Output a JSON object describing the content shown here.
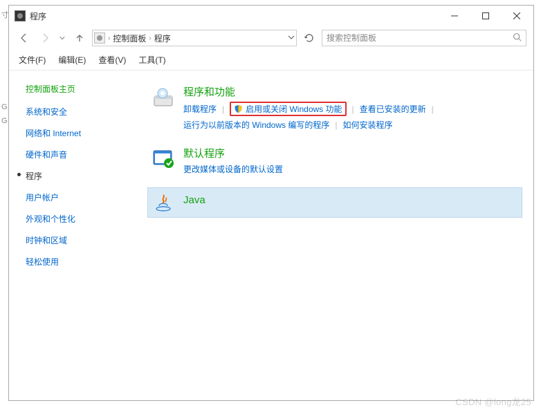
{
  "titlebar": {
    "title": "程序"
  },
  "breadcrumb": {
    "root": "控制面板",
    "current": "程序"
  },
  "search": {
    "placeholder": "搜索控制面板"
  },
  "menubar": {
    "file": "文件(F)",
    "edit": "编辑(E)",
    "view": "查看(V)",
    "tools": "工具(T)"
  },
  "sidebar": {
    "title": "控制面板主页",
    "items": [
      {
        "label": "系统和安全"
      },
      {
        "label": "网络和 Internet"
      },
      {
        "label": "硬件和声音"
      },
      {
        "label": "程序",
        "active": true
      },
      {
        "label": "用户帐户"
      },
      {
        "label": "外观和个性化"
      },
      {
        "label": "时钟和区域"
      },
      {
        "label": "轻松使用"
      }
    ]
  },
  "categories": {
    "programs": {
      "title": "程序和功能",
      "links": {
        "uninstall": "卸载程序",
        "winfeatures": "启用或关闭 Windows 功能",
        "installed": "查看已安装的更新",
        "compat": "运行为以前版本的 Windows 编写的程序",
        "howto": "如何安装程序"
      }
    },
    "defaults": {
      "title": "默认程序",
      "links": {
        "change": "更改媒体或设备的默认设置"
      }
    },
    "java": {
      "title": "Java"
    }
  },
  "watermark": "CSDN @long龙25",
  "leftstrip": {
    "c1": "寸",
    "c2": "G",
    "c3": "G"
  }
}
